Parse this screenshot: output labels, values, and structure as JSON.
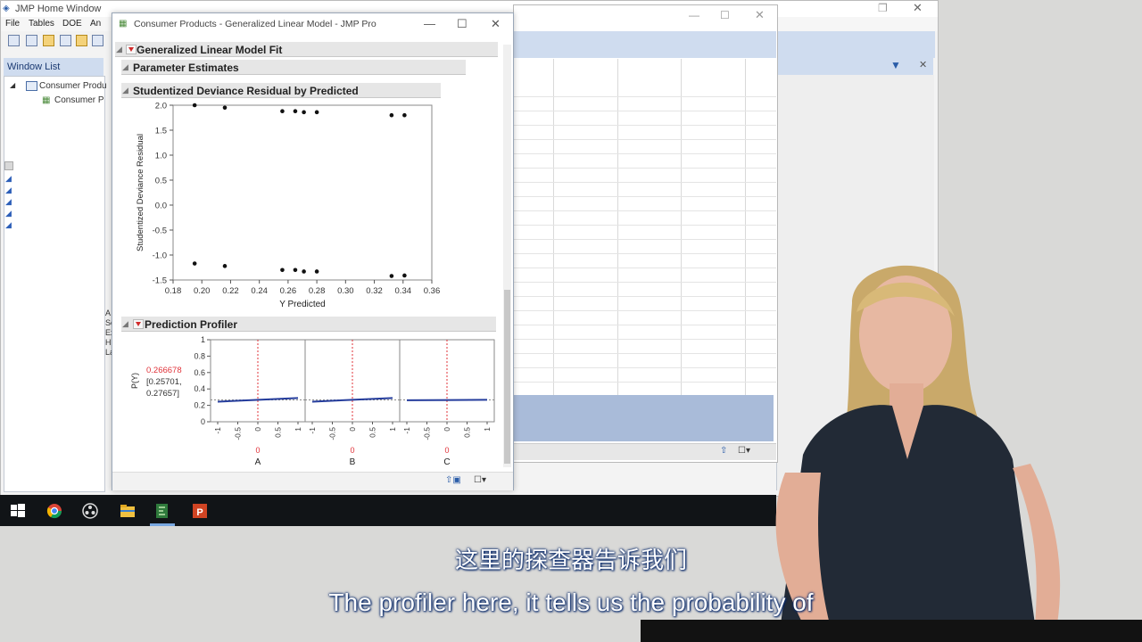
{
  "home": {
    "title": "JMP Home Window",
    "menu": [
      "File",
      "Tables",
      "DOE",
      "An"
    ],
    "window_list_title": "Window List",
    "tree": [
      "Consumer Produ",
      "Consumer P"
    ],
    "left_stub_labels": [
      "A",
      "Se",
      "Ex",
      "H",
      "La"
    ]
  },
  "glm": {
    "window_title": "Consumer Products - Generalized Linear Model - JMP Pro",
    "outline_main": "Generalized Linear Model Fit",
    "outline_params": "Parameter Estimates",
    "outline_residual": "Studentized Deviance Residual by Predicted",
    "outline_profiler": "Prediction Profiler",
    "controls": {
      "minimize": "—",
      "maximize": "☐",
      "close": "✕"
    }
  },
  "chart_data": [
    {
      "type": "scatter",
      "title": "",
      "xlabel": "Y Predicted",
      "ylabel": "Studentized Deviance Residual",
      "x_ticks": [
        "0.18",
        "0.20",
        "0.22",
        "0.24",
        "0.26",
        "0.28",
        "0.30",
        "0.32",
        "0.34",
        "0.36"
      ],
      "y_ticks": [
        "2.0",
        "1.5",
        "1.0",
        "0.5",
        "0.0",
        "-0.5",
        "-1.0",
        "-1.5"
      ],
      "xlim": [
        0.18,
        0.36
      ],
      "ylim": [
        -1.5,
        2.0
      ],
      "points": [
        {
          "x": 0.195,
          "y": 2.0
        },
        {
          "x": 0.216,
          "y": 1.95
        },
        {
          "x": 0.256,
          "y": 1.88
        },
        {
          "x": 0.265,
          "y": 1.88
        },
        {
          "x": 0.271,
          "y": 1.86
        },
        {
          "x": 0.28,
          "y": 1.86
        },
        {
          "x": 0.332,
          "y": 1.8
        },
        {
          "x": 0.341,
          "y": 1.8
        },
        {
          "x": 0.195,
          "y": -1.17
        },
        {
          "x": 0.216,
          "y": -1.22
        },
        {
          "x": 0.256,
          "y": -1.3
        },
        {
          "x": 0.265,
          "y": -1.3
        },
        {
          "x": 0.271,
          "y": -1.33
        },
        {
          "x": 0.28,
          "y": -1.33
        },
        {
          "x": 0.332,
          "y": -1.42
        },
        {
          "x": 0.341,
          "y": -1.41
        }
      ]
    },
    {
      "type": "line",
      "title": "Prediction Profiler",
      "ylabel": "P(Y)",
      "current_value": "0.266678",
      "interval": "[0.25701,\n0.27657]",
      "y_ticks": [
        "1",
        "0.8",
        "0.6",
        "0.4",
        "0.2",
        "0"
      ],
      "ylim": [
        0,
        1
      ],
      "x_ticks": [
        "-1",
        "-0.5",
        "0",
        "0.5",
        "1"
      ],
      "factors": [
        {
          "name": "A",
          "current": "0",
          "y_at_minus1": 0.245,
          "y_at_plus1": 0.29
        },
        {
          "name": "B",
          "current": "0",
          "y_at_minus1": 0.245,
          "y_at_plus1": 0.29
        },
        {
          "name": "C",
          "current": "0",
          "y_at_minus1": 0.262,
          "y_at_plus1": 0.268
        }
      ]
    }
  ],
  "subtitles": {
    "cn": "这里的探查器告诉我们",
    "en": "The profiler here, it tells us the probability of"
  },
  "colors": {
    "profile_line": "#243c9c",
    "current_marker": "#e0333a",
    "accent_blue": "#cfdcef"
  }
}
